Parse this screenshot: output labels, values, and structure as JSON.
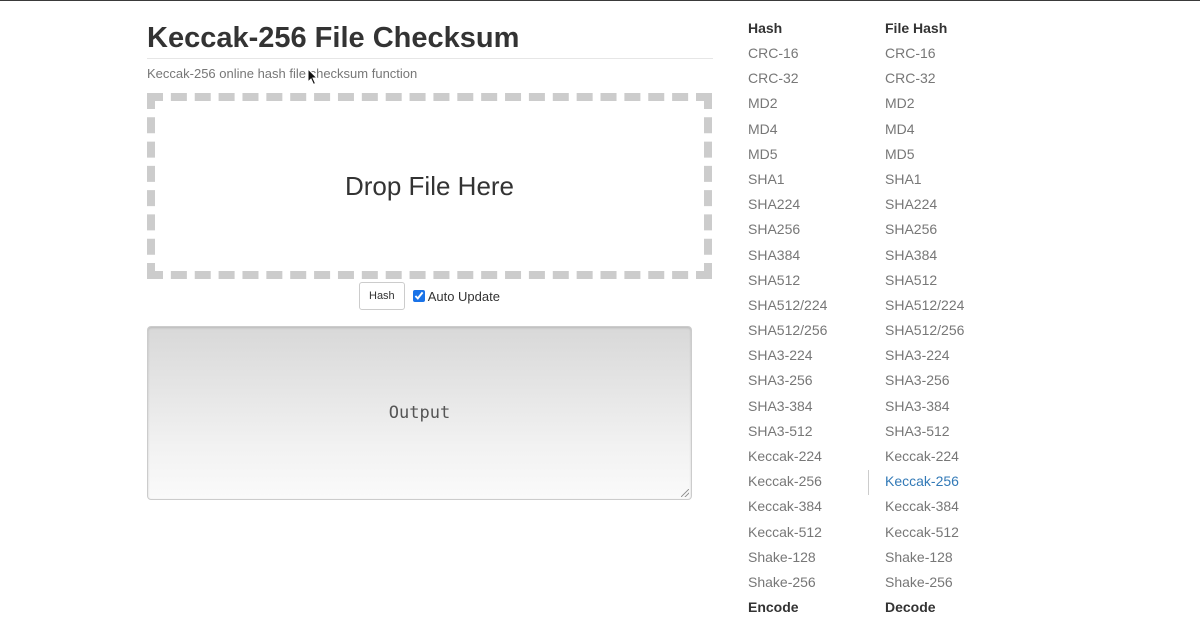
{
  "page": {
    "title": "Keccak-256 File Checksum",
    "subtitle": "Keccak-256 online hash file checksum function"
  },
  "drop_zone": {
    "label": "Drop File Here"
  },
  "controls": {
    "hash_button": "Hash",
    "auto_update_label": "Auto Update",
    "auto_update_checked": true
  },
  "output": {
    "placeholder": "Output"
  },
  "hash_column": {
    "header": "Hash",
    "items": [
      "CRC-16",
      "CRC-32",
      "MD2",
      "MD4",
      "MD5",
      "SHA1",
      "SHA224",
      "SHA256",
      "SHA384",
      "SHA512",
      "SHA512/224",
      "SHA512/256",
      "SHA3-224",
      "SHA3-256",
      "SHA3-384",
      "SHA3-512",
      "Keccak-224",
      "Keccak-256",
      "Keccak-384",
      "Keccak-512",
      "Shake-128",
      "Shake-256"
    ],
    "next_header": "Encode"
  },
  "file_hash_column": {
    "header": "File Hash",
    "items": [
      "CRC-16",
      "CRC-32",
      "MD2",
      "MD4",
      "MD5",
      "SHA1",
      "SHA224",
      "SHA256",
      "SHA384",
      "SHA512",
      "SHA512/224",
      "SHA512/256",
      "SHA3-224",
      "SHA3-256",
      "SHA3-384",
      "SHA3-512",
      "Keccak-224",
      "Keccak-256",
      "Keccak-384",
      "Keccak-512",
      "Shake-128",
      "Shake-256"
    ],
    "active": "Keccak-256",
    "next_header": "Decode"
  },
  "colors": {
    "link": "#777777",
    "active_link": "#337ab7",
    "drop_border": "#cccccc",
    "checkbox": "#1a73e8"
  }
}
